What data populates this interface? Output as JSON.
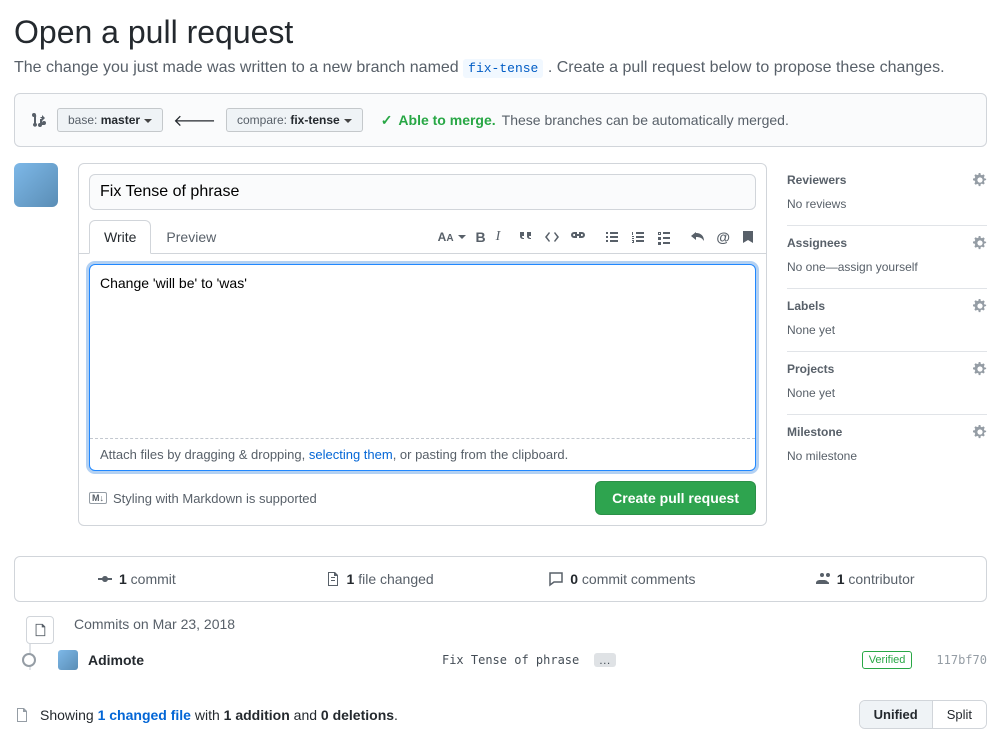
{
  "page_title": "Open a pull request",
  "subtitle_prefix": "The change you just made was written to a new branch named ",
  "branch_name": "fix-tense",
  "subtitle_suffix": ". Create a pull request below to propose these changes.",
  "base_label": "base: ",
  "base_value": "master",
  "compare_label": "compare: ",
  "compare_value": "fix-tense",
  "arrow_icon": "🡐",
  "merge_status": "Able to merge.",
  "merge_msg": "These branches can be automatically merged.",
  "pr_title": "Fix Tense of phrase",
  "tabs": {
    "write": "Write",
    "preview": "Preview"
  },
  "description": "Change 'will be' to 'was'",
  "attach_prefix": "Attach files by dragging & dropping, ",
  "attach_link": "selecting them",
  "attach_suffix": ", or pasting from the clipboard.",
  "md_hint": "Styling with Markdown is supported",
  "md_badge": "M↓",
  "create_btn": "Create pull request",
  "sidebar": {
    "reviewers": {
      "title": "Reviewers",
      "value": "No reviews"
    },
    "assignees": {
      "title": "Assignees",
      "value_prefix": "No one—",
      "assign_self": "assign yourself"
    },
    "labels": {
      "title": "Labels",
      "value": "None yet"
    },
    "projects": {
      "title": "Projects",
      "value": "None yet"
    },
    "milestone": {
      "title": "Milestone",
      "value": "No milestone"
    }
  },
  "stats": {
    "commits_n": "1",
    "commits_l": "commit",
    "files_n": "1",
    "files_l": "file changed",
    "comments_n": "0",
    "comments_l": "commit comments",
    "contrib_n": "1",
    "contrib_l": "contributor"
  },
  "timeline": {
    "header": "Commits on Mar 23, 2018",
    "commit": {
      "author": "Adimote",
      "message": "Fix Tense of phrase",
      "verified": "Verified",
      "sha": "117bf70"
    }
  },
  "diff": {
    "prefix": "Showing ",
    "files": "1 changed file",
    "with": " with ",
    "add": "1 addition",
    "and": " and ",
    "del": "0 deletions",
    "end": ".",
    "unified": "Unified",
    "split": "Split"
  }
}
